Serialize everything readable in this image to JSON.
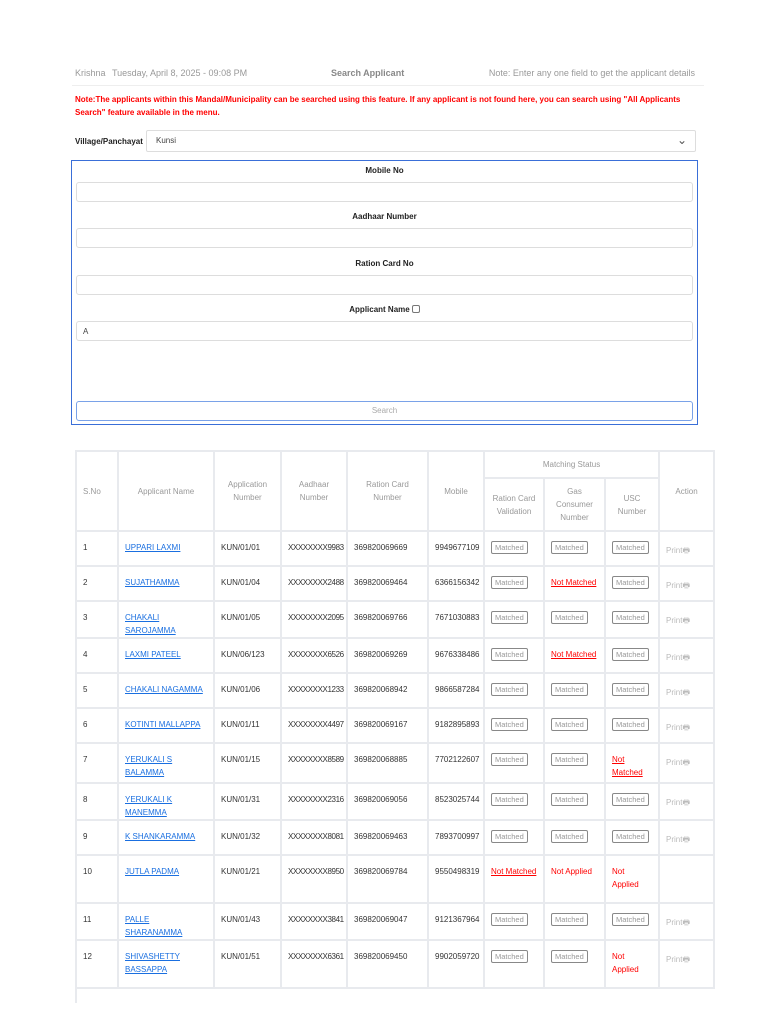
{
  "header": {
    "user": "Krishna",
    "datetime": "Tuesday, April 8, 2025 - 09:08 PM",
    "title": "Search Applicant",
    "hint": "Note: Enter any one field to get the applicant details"
  },
  "note": "Note:The applicants within this Mandal/Municipality can be searched using this feature. If any applicant is not found here, you can search using \"All Applicants Search\" feature available in the menu.",
  "village": {
    "label": "Village/Panchayat",
    "value": "Kunsi"
  },
  "form": {
    "mobile_label": "Mobile No",
    "mobile_value": "",
    "aadhaar_label": "Aadhaar Number",
    "aadhaar_value": "",
    "ration_label": "Ration Card No",
    "ration_value": "",
    "name_label": "Applicant Name",
    "name_value": "A",
    "search_label": "Search"
  },
  "table": {
    "headers": {
      "sno": "S.No",
      "name": "Applicant Name",
      "app": "Application Number",
      "aadhaar": "Aadhaar Number",
      "ration": "Ration Card Number",
      "mobile": "Mobile",
      "matching": "Matching Status",
      "rcv": "Ration Card Validation",
      "gas": "Gas Consumer Number",
      "usc": "USC Number",
      "action": "Action"
    },
    "print_label": "Print",
    "rows": [
      {
        "sno": "1",
        "name": "UPPARI LAXMI",
        "app": "KUN/01/01",
        "aadhaar": "XXXXXXXX9983",
        "ration": "369820069669",
        "mobile": "9949677109",
        "rcv": "Matched",
        "gas": "Matched",
        "usc": "Matched",
        "rcv_t": "m",
        "gas_t": "m",
        "usc_t": "m",
        "print": true
      },
      {
        "sno": "2",
        "name": "SUJATHAMMA",
        "app": "KUN/01/04",
        "aadhaar": "XXXXXXXX2488",
        "ration": "369820069464",
        "mobile": "6366156342",
        "rcv": "Matched",
        "gas": "Not Matched",
        "usc": "Matched",
        "rcv_t": "m",
        "gas_t": "nm",
        "usc_t": "m",
        "print": true
      },
      {
        "sno": "3",
        "name": "CHAKALI SAROJAMMA",
        "app": "KUN/01/05",
        "aadhaar": "XXXXXXXX2095",
        "ration": "369820069766",
        "mobile": "7671030883",
        "rcv": "Matched",
        "gas": "Matched",
        "usc": "Matched",
        "rcv_t": "m",
        "gas_t": "m",
        "usc_t": "m",
        "print": true
      },
      {
        "sno": "4",
        "name": "LAXMI PATEEL",
        "app": "KUN/06/123",
        "aadhaar": "XXXXXXXX6526",
        "ration": "369820069269",
        "mobile": "9676338486",
        "rcv": "Matched",
        "gas": "Not Matched",
        "usc": "Matched",
        "rcv_t": "m",
        "gas_t": "nm",
        "usc_t": "m",
        "print": true
      },
      {
        "sno": "5",
        "name": "CHAKALI NAGAMMA",
        "app": "KUN/01/06",
        "aadhaar": "XXXXXXXX1233",
        "ration": "369820068942",
        "mobile": "9866587284",
        "rcv": "Matched",
        "gas": "Matched",
        "usc": "Matched",
        "rcv_t": "m",
        "gas_t": "m",
        "usc_t": "m",
        "print": true
      },
      {
        "sno": "6",
        "name": "KOTINTI MALLAPPA",
        "app": "KUN/01/11",
        "aadhaar": "XXXXXXXX4497",
        "ration": "369820069167",
        "mobile": "9182895893",
        "rcv": "Matched",
        "gas": "Matched",
        "usc": "Matched",
        "rcv_t": "m",
        "gas_t": "m",
        "usc_t": "m",
        "print": true
      },
      {
        "sno": "7",
        "name": "YERUKALI S BALAMMA",
        "app": "KUN/01/15",
        "aadhaar": "XXXXXXXX8589",
        "ration": "369820068885",
        "mobile": "7702122607",
        "rcv": "Matched",
        "gas": "Matched",
        "usc": "Not Matched",
        "rcv_t": "m",
        "gas_t": "m",
        "usc_t": "nm",
        "print": true
      },
      {
        "sno": "8",
        "name": "YERUKALI K MANEMMA",
        "app": "KUN/01/31",
        "aadhaar": "XXXXXXXX2316",
        "ration": "369820069056",
        "mobile": "8523025744",
        "rcv": "Matched",
        "gas": "Matched",
        "usc": "Matched",
        "rcv_t": "m",
        "gas_t": "m",
        "usc_t": "m",
        "print": true
      },
      {
        "sno": "9",
        "name": "K SHANKARAMMA",
        "app": "KUN/01/32",
        "aadhaar": "XXXXXXXX8081",
        "ration": "369820069463",
        "mobile": "7893700997",
        "rcv": "Matched",
        "gas": "Matched",
        "usc": "Matched",
        "rcv_t": "m",
        "gas_t": "m",
        "usc_t": "m",
        "print": true
      },
      {
        "sno": "10",
        "name": "JUTLA PADMA",
        "app": "KUN/01/21",
        "aadhaar": "XXXXXXXX8950",
        "ration": "369820069784",
        "mobile": "9550498319",
        "rcv": "Not Matched",
        "gas": "Not Applied",
        "usc": "Not Applied",
        "rcv_t": "nm",
        "gas_t": "na",
        "usc_t": "na",
        "print": false
      },
      {
        "sno": "11",
        "name": "PALLE SHARANAMMA",
        "app": "KUN/01/43",
        "aadhaar": "XXXXXXXX3841",
        "ration": "369820069047",
        "mobile": "9121367964",
        "rcv": "Matched",
        "gas": "Matched",
        "usc": "Matched",
        "rcv_t": "m",
        "gas_t": "m",
        "usc_t": "m",
        "print": true
      },
      {
        "sno": "12",
        "name": "SHIVASHETTY BASSAPPA",
        "app": "KUN/01/51",
        "aadhaar": "XXXXXXXX6361",
        "ration": "369820069450",
        "mobile": "9902059720",
        "rcv": "Matched",
        "gas": "Matched",
        "usc": "Not Applied",
        "rcv_t": "m",
        "gas_t": "m",
        "usc_t": "na",
        "print": true
      }
    ]
  }
}
